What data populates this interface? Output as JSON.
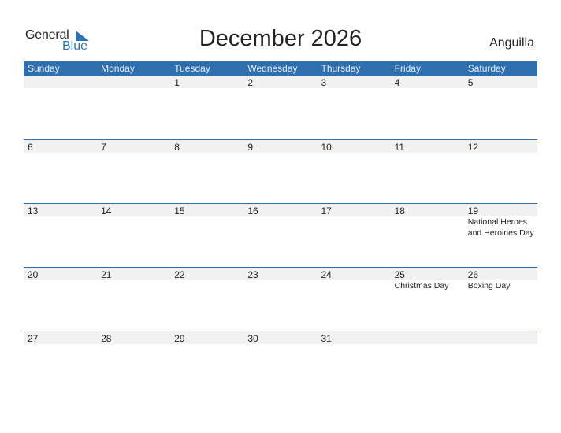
{
  "logo": {
    "word1": "General",
    "word2": "Blue"
  },
  "title": "December 2026",
  "country": "Anguilla",
  "colors": {
    "accent": "#2e6fb0",
    "strip": "#f1f1f1"
  },
  "weekdays": [
    "Sunday",
    "Monday",
    "Tuesday",
    "Wednesday",
    "Thursday",
    "Friday",
    "Saturday"
  ],
  "weeks": [
    {
      "days": [
        "",
        "",
        "1",
        "2",
        "3",
        "4",
        "5"
      ],
      "events": [
        "",
        "",
        "",
        "",
        "",
        "",
        ""
      ]
    },
    {
      "days": [
        "6",
        "7",
        "8",
        "9",
        "10",
        "11",
        "12"
      ],
      "events": [
        "",
        "",
        "",
        "",
        "",
        "",
        ""
      ]
    },
    {
      "days": [
        "13",
        "14",
        "15",
        "16",
        "17",
        "18",
        "19"
      ],
      "events": [
        "",
        "",
        "",
        "",
        "",
        "",
        "National Heroes and Heroines Day"
      ]
    },
    {
      "days": [
        "20",
        "21",
        "22",
        "23",
        "24",
        "25",
        "26"
      ],
      "events": [
        "",
        "",
        "",
        "",
        "",
        "Christmas Day",
        "Boxing Day"
      ]
    },
    {
      "days": [
        "27",
        "28",
        "29",
        "30",
        "31",
        "",
        ""
      ],
      "events": [
        "",
        "",
        "",
        "",
        "",
        "",
        ""
      ]
    }
  ]
}
